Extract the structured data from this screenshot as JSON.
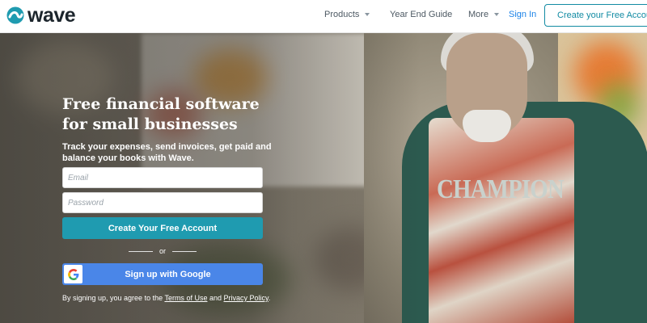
{
  "brand": {
    "name": "wave",
    "accent": "#1f9bb0",
    "link_color": "#1c83e8"
  },
  "nav": {
    "products": "Products",
    "year_end_guide": "Year End Guide",
    "more": "More",
    "sign_in": "Sign In",
    "create_account": "Create your Free Account"
  },
  "hero": {
    "headline_line1": "Free financial software",
    "headline_line2": "for small businesses",
    "subtext": "Track your expenses, send invoices, get paid and balance your books with Wave.",
    "shirt_text": "CHAMPION"
  },
  "form": {
    "email_placeholder": "Email",
    "password_placeholder": "Password",
    "create_button": "Create Your Free Account",
    "or": "or",
    "google_button": "Sign up with Google",
    "legal_prefix": "By signing up, you agree to the",
    "terms": "Terms of Use",
    "and": "and",
    "privacy": "Privacy Policy",
    "period": "."
  },
  "icons": {
    "logo": "wave-logo-icon",
    "google": "google-g-icon",
    "caret": "caret-down-icon"
  }
}
